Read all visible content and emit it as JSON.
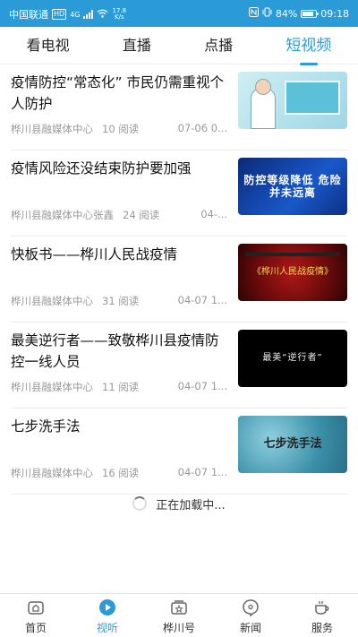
{
  "status_bar": {
    "carrier": "中国联通",
    "hd": "HD",
    "network": "4G",
    "speed_value": "17.8",
    "speed_unit": "K/s",
    "battery": "84%",
    "battery_level": 0.84,
    "time": "09:18"
  },
  "tabs": [
    {
      "label": "看电视"
    },
    {
      "label": "直播"
    },
    {
      "label": "点播"
    },
    {
      "label": "短视频"
    }
  ],
  "news": [
    {
      "title": "疫情防控“常态化” 市民仍需重视个人防护",
      "source": "桦川县融媒体中心",
      "reads": "10 阅读",
      "date": "07-06 0...",
      "thumb_text": ""
    },
    {
      "title": "疫情风险还没结束防护要加强",
      "source": "桦川县融媒体中心张鑫",
      "reads": "24 阅读",
      "date": "04-...",
      "thumb_text": "防控等级降低 危险并未远离"
    },
    {
      "title": "快板书——桦川人民战疫情",
      "source": "桦川县融媒体中心",
      "reads": "31 阅读",
      "date": "04-07 1...",
      "thumb_text": "《桦川人民战疫情》"
    },
    {
      "title": "最美逆行者——致敬桦川县疫情防控一线人员",
      "source": "桦川县融媒体中心",
      "reads": "11 阅读",
      "date": "04-07 1...",
      "thumb_text": "最美“逆行者”"
    },
    {
      "title": "七步洗手法",
      "source": "桦川县融媒体中心",
      "reads": "16 阅读",
      "date": "04-07 1...",
      "thumb_text": "七步洗手法"
    }
  ],
  "loading": "正在加载中...",
  "bottom_nav": [
    {
      "label": "首页",
      "icon": "home-icon"
    },
    {
      "label": "视听",
      "icon": "play-icon"
    },
    {
      "label": "桦川号",
      "icon": "media-account-icon"
    },
    {
      "label": "新闻",
      "icon": "news-bubble-icon"
    },
    {
      "label": "服务",
      "icon": "coffee-cup-icon"
    }
  ],
  "colors": {
    "accent": "#2b9bd8",
    "text": "#111111",
    "meta": "#999999"
  }
}
